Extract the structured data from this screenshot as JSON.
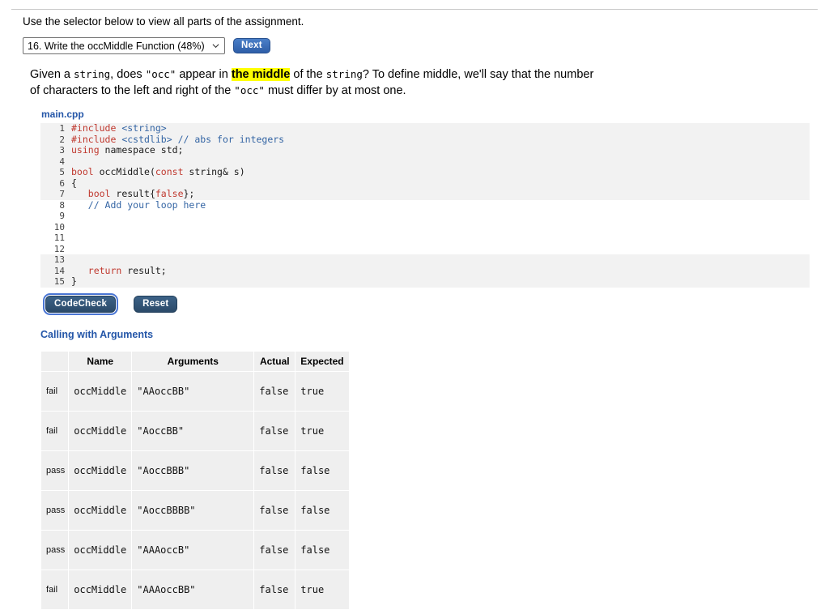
{
  "intro": {
    "text": "Use the selector below to view all parts of the assignment."
  },
  "selector": {
    "selected_option": "16. Write the occMiddle Function (48%)",
    "options": [
      "16. Write the occMiddle Function (48%)"
    ],
    "chevron_icon": "chevron-down-icon",
    "next_label": "Next"
  },
  "problem": {
    "seg1": "Given a ",
    "code1": "string",
    "seg2": ", does ",
    "code2": "\"occ\"",
    "seg3": " appear in ",
    "highlight": "the middle",
    "seg4": " of the ",
    "code3": "string",
    "seg5": "? To define middle, we'll say that the number of characters to the left and right of the ",
    "code4": "\"occ\"",
    "seg6": " must differ by at most one."
  },
  "editor": {
    "file_label": "main.cpp",
    "readonly_top": [
      {
        "num": "1",
        "tokens": [
          {
            "t": "#include ",
            "c": "tok-pre"
          },
          {
            "t": "<string>",
            "c": "tok-hdr"
          }
        ]
      },
      {
        "num": "2",
        "tokens": [
          {
            "t": "#include ",
            "c": "tok-pre"
          },
          {
            "t": "<cstdlib>",
            "c": "tok-hdr"
          },
          {
            "t": " ",
            "c": "tok-id"
          },
          {
            "t": "// abs for integers",
            "c": "tok-cmt"
          }
        ]
      },
      {
        "num": "3",
        "tokens": [
          {
            "t": "using",
            "c": "tok-kw"
          },
          {
            "t": " namespace std;",
            "c": "tok-id"
          }
        ]
      },
      {
        "num": "4",
        "tokens": [
          {
            "t": "",
            "c": "tok-id"
          }
        ]
      },
      {
        "num": "5",
        "tokens": [
          {
            "t": "bool",
            "c": "tok-kw"
          },
          {
            "t": " occMiddle(",
            "c": "tok-id"
          },
          {
            "t": "const",
            "c": "tok-kw"
          },
          {
            "t": " string& s)",
            "c": "tok-id"
          }
        ]
      },
      {
        "num": "6",
        "tokens": [
          {
            "t": "{",
            "c": "tok-id"
          }
        ]
      },
      {
        "num": "7",
        "tokens": [
          {
            "t": "   ",
            "c": "tok-id"
          },
          {
            "t": "bool",
            "c": "tok-kw"
          },
          {
            "t": " result{",
            "c": "tok-id"
          },
          {
            "t": "false",
            "c": "tok-lit"
          },
          {
            "t": "};",
            "c": "tok-id"
          }
        ]
      }
    ],
    "editable": [
      {
        "num": "8",
        "tokens": [
          {
            "t": "   ",
            "c": "tok-id"
          },
          {
            "t": "// Add your loop here",
            "c": "tok-cmt"
          }
        ]
      },
      {
        "num": "9",
        "tokens": [
          {
            "t": "",
            "c": "tok-id"
          }
        ]
      },
      {
        "num": "10",
        "tokens": [
          {
            "t": "",
            "c": "tok-id"
          }
        ]
      },
      {
        "num": "11",
        "tokens": [
          {
            "t": "",
            "c": "tok-id"
          }
        ]
      },
      {
        "num": "12",
        "tokens": [
          {
            "t": "",
            "c": "tok-id"
          }
        ]
      }
    ],
    "readonly_bottom": [
      {
        "num": "13",
        "tokens": [
          {
            "t": "",
            "c": "tok-id"
          }
        ]
      },
      {
        "num": "14",
        "tokens": [
          {
            "t": "   ",
            "c": "tok-id"
          },
          {
            "t": "return",
            "c": "tok-kw"
          },
          {
            "t": " result;",
            "c": "tok-id"
          }
        ]
      },
      {
        "num": "15",
        "tokens": [
          {
            "t": "}",
            "c": "tok-id"
          }
        ]
      }
    ]
  },
  "actions": {
    "codecheck_label": "CodeCheck",
    "reset_label": "Reset"
  },
  "results": {
    "heading": "Calling with Arguments",
    "columns": [
      "",
      "Name",
      "Arguments",
      "Actual",
      "Expected"
    ],
    "rows": [
      {
        "status": "fail",
        "name": "occMiddle",
        "arguments": "\"AAoccBB\"",
        "actual": "false",
        "expected": "true"
      },
      {
        "status": "fail",
        "name": "occMiddle",
        "arguments": "\"AoccBB\"",
        "actual": "false",
        "expected": "true"
      },
      {
        "status": "pass",
        "name": "occMiddle",
        "arguments": "\"AoccBBB\"",
        "actual": "false",
        "expected": "false"
      },
      {
        "status": "pass",
        "name": "occMiddle",
        "arguments": "\"AoccBBBB\"",
        "actual": "false",
        "expected": "false"
      },
      {
        "status": "pass",
        "name": "occMiddle",
        "arguments": "\"AAAoccB\"",
        "actual": "false",
        "expected": "false"
      },
      {
        "status": "fail",
        "name": "occMiddle",
        "arguments": "\"AAAoccBB\"",
        "actual": "false",
        "expected": "true"
      }
    ]
  },
  "colors": {
    "accent_blue": "#2456a8",
    "highlight_yellow": "#ffff00",
    "pass_green": "#2e8b37",
    "fail_red": "#e8432e",
    "code_keyword": "#c0392f",
    "code_comment": "#3465a4"
  }
}
